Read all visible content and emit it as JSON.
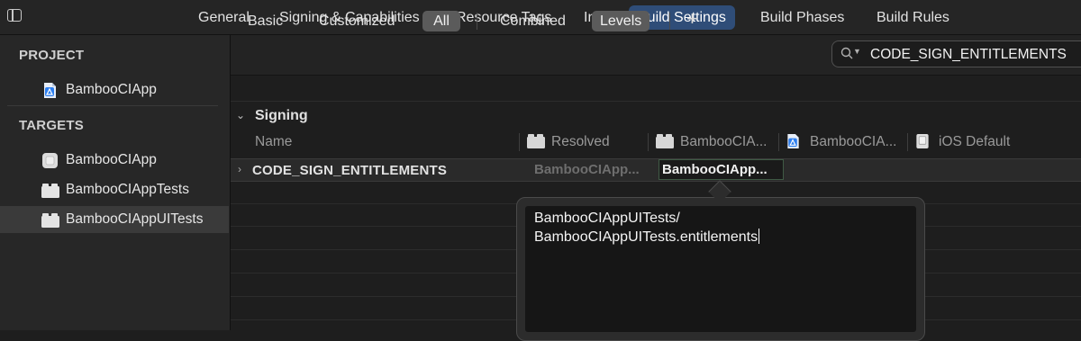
{
  "top_tabs": [
    "General",
    "Signing & Capabilities",
    "Resource Tags",
    "Info",
    "Build Settings",
    "Build Phases",
    "Build Rules"
  ],
  "active_top_tab": "Build Settings",
  "sidebar": {
    "project_header": "PROJECT",
    "project_item": "BambooCIApp",
    "targets_header": "TARGETS",
    "targets": [
      "BambooCIApp",
      "BambooCIAppTests",
      "BambooCIAppUITests"
    ],
    "selected_target": "BambooCIAppUITests"
  },
  "filters": {
    "basic": "Basic",
    "customized": "Customized",
    "all": "All",
    "combined": "Combined",
    "levels": "Levels",
    "add": "+"
  },
  "search": {
    "value": "CODE_SIGN_ENTITLEMENTS"
  },
  "section": {
    "title": "Signing"
  },
  "columns": {
    "name": "Name",
    "resolved": "Resolved",
    "target": "BambooCIA...",
    "project": "BambooCIA...",
    "ios_default": "iOS Default"
  },
  "row": {
    "name": "CODE_SIGN_ENTITLEMENTS",
    "resolved_value": "BambooCIApp...",
    "target_value": "BambooCIApp..."
  },
  "editor": {
    "line1": "BambooCIAppUITests/",
    "line2": "BambooCIAppUITests.entitlements"
  },
  "icons": [
    "sidebar-toggle-icon",
    "app-project-icon",
    "app-target-icon",
    "target-bundle-icon",
    "search-icon",
    "chevron-icon"
  ],
  "colors": {
    "accent": "#2f4d78",
    "background": "#1e1e1e",
    "selection": "#3a3a3a"
  }
}
